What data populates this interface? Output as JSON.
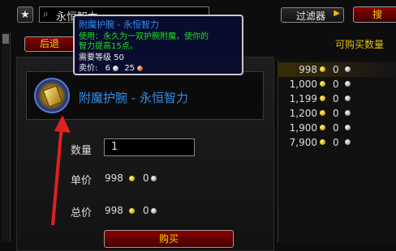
{
  "toolbar": {
    "star_icon": "★",
    "search_value": "永恒智力",
    "filter_label": "过滤器",
    "search_button": "搜"
  },
  "back_button": "后退",
  "item": {
    "name": "附魔护腕 - 永恒智力"
  },
  "tooltip": {
    "title": "附魔护腕 - 永恒智力",
    "use_line1": "使用：永久为一双护腕附魔，使你的",
    "use_line2": "智力提高15点。",
    "level_req": "需要等级 50",
    "sell_label": "卖价:",
    "sell_silver": "6",
    "sell_copper": "25"
  },
  "form": {
    "quantity_label": "数量",
    "quantity_value": "1",
    "unit_price_label": "单价",
    "unit_price_gold": "998",
    "unit_price_silver": "0",
    "total_label": "总价",
    "total_gold": "998",
    "total_silver": "0",
    "buy_button": "购买"
  },
  "right_panel": {
    "header": "可购买数量",
    "rows": [
      {
        "gold": "998",
        "silver": "0"
      },
      {
        "gold": "1,000",
        "silver": "0"
      },
      {
        "gold": "1,199",
        "silver": "0"
      },
      {
        "gold": "1,200",
        "silver": "0"
      },
      {
        "gold": "1,900",
        "silver": "0"
      },
      {
        "gold": "7,900",
        "silver": "0"
      }
    ]
  },
  "colors": {
    "item_quality": "#2f8ff0",
    "annotation_arrow": "#e02020",
    "gold_text": "#e8c200"
  }
}
